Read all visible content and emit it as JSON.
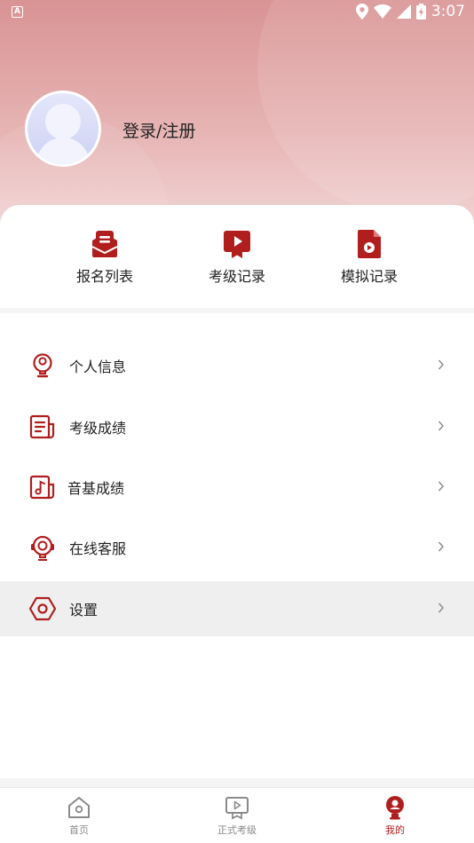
{
  "status_bar": {
    "left_badge": "A",
    "time": "3:07"
  },
  "profile": {
    "login_label": "登录/注册"
  },
  "quick_actions": [
    {
      "label": "报名列表",
      "icon": "clipboard-list-icon"
    },
    {
      "label": "考级记录",
      "icon": "video-play-badge-icon"
    },
    {
      "label": "模拟记录",
      "icon": "document-play-icon"
    }
  ],
  "menu": [
    {
      "label": "个人信息",
      "icon": "user-bulb-icon"
    },
    {
      "label": "考级成绩",
      "icon": "report-icon"
    },
    {
      "label": "音基成绩",
      "icon": "music-note-icon"
    },
    {
      "label": "在线客服",
      "icon": "headset-icon"
    },
    {
      "label": "设置",
      "icon": "hexagon-settings-icon"
    }
  ],
  "tabbar": {
    "tabs": [
      {
        "label": "首页",
        "icon": "home-icon"
      },
      {
        "label": "正式考级",
        "icon": "screen-play-icon"
      },
      {
        "label": "我的",
        "icon": "profile-icon"
      }
    ],
    "active_index": 2
  },
  "colors": {
    "accent": "#b01e1e",
    "header_top": "#d99394",
    "header_bottom": "#f3d8d8",
    "active_row": "#efefef"
  }
}
